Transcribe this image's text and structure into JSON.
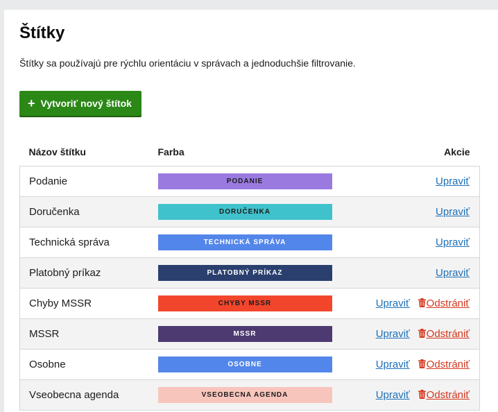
{
  "page": {
    "title": "Štítky",
    "description": "Štítky sa používajú pre rýchlu orientáciu v správach a jednoduchšie filtrovanie.",
    "create_button": "Vytvoriť nový štítok"
  },
  "table": {
    "headers": {
      "name": "Názov štítku",
      "color": "Farba",
      "actions": "Akcie"
    },
    "edit_label": "Upraviť",
    "delete_label": "Odstrániť",
    "rows": [
      {
        "name": "Podanie",
        "badge": "PODANIE",
        "bg": "#9b7ae0",
        "fg": "#1b1b1b",
        "deletable": false
      },
      {
        "name": "Doručenka",
        "badge": "DORUČENKA",
        "bg": "#40c2cc",
        "fg": "#1b1b1b",
        "deletable": false
      },
      {
        "name": "Technická správa",
        "badge": "TECHNICKÁ SPRÁVA",
        "bg": "#5386ea",
        "fg": "#ffffff",
        "deletable": false
      },
      {
        "name": "Platobný príkaz",
        "badge": "PLATOBNÝ PRÍKAZ",
        "bg": "#2a3f6e",
        "fg": "#ffffff",
        "deletable": false
      },
      {
        "name": "Chyby MSSR",
        "badge": "CHYBY MSSR",
        "bg": "#f2462c",
        "fg": "#1b1b1b",
        "deletable": true
      },
      {
        "name": "MSSR",
        "badge": "MSSR",
        "bg": "#4d3a70",
        "fg": "#ffffff",
        "deletable": true
      },
      {
        "name": "Osobne",
        "badge": "OSOBNE",
        "bg": "#5386ea",
        "fg": "#ffffff",
        "deletable": true
      },
      {
        "name": "Vseobecna agenda",
        "badge": "VSEOBECNA AGENDA",
        "bg": "#f8c5bd",
        "fg": "#1b1b1b",
        "deletable": true
      }
    ]
  },
  "icons": {
    "plus": "plus-icon",
    "trash": "trash-icon"
  }
}
